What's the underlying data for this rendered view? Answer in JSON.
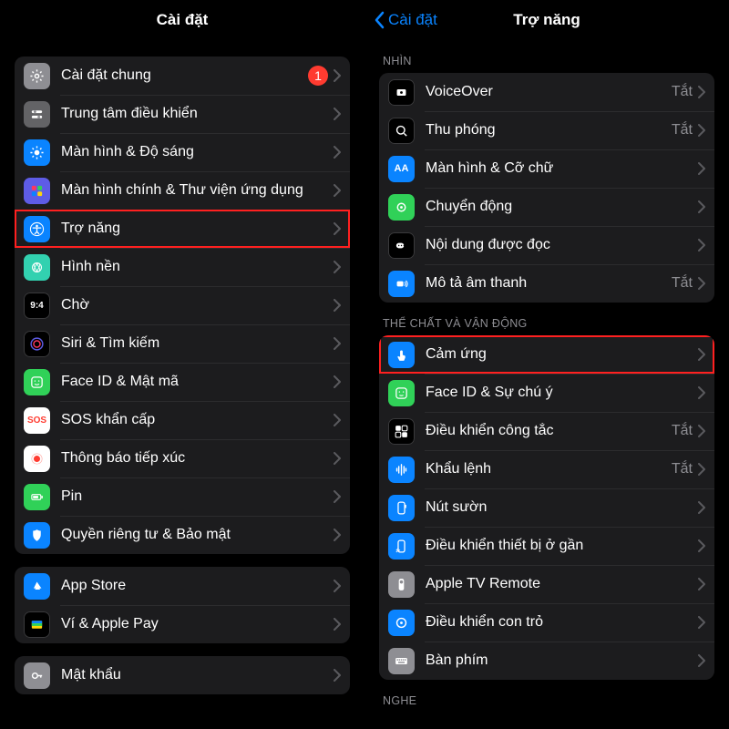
{
  "left": {
    "title": "Cài đặt",
    "groups": [
      {
        "items": [
          {
            "icon": "gear-icon",
            "cls": "c-gray",
            "label": "Cài đặt chung",
            "badge": "1"
          },
          {
            "icon": "control-center-icon",
            "cls": "c-dgray",
            "label": "Trung tâm điều khiển"
          },
          {
            "icon": "brightness-icon",
            "cls": "c-blue",
            "label": "Màn hình & Độ sáng"
          },
          {
            "icon": "home-screen-icon",
            "cls": "c-purple",
            "label": "Màn hình chính & Thư viện ứng dụng"
          },
          {
            "icon": "accessibility-icon",
            "cls": "c-blue",
            "label": "Trợ năng",
            "hl": true
          },
          {
            "icon": "wallpaper-icon",
            "cls": "c-mint",
            "label": "Hình nền"
          },
          {
            "icon": "standby-icon",
            "cls": "c-black",
            "label": "Chờ"
          },
          {
            "icon": "siri-icon",
            "cls": "c-black",
            "label": "Siri & Tìm kiếm"
          },
          {
            "icon": "faceid-icon",
            "cls": "c-green",
            "label": "Face ID & Mật mã"
          },
          {
            "icon": "sos-icon",
            "cls": "c-sos",
            "label": "SOS khẩn cấp"
          },
          {
            "icon": "exposure-icon",
            "cls": "c-white",
            "label": "Thông báo tiếp xúc"
          },
          {
            "icon": "battery-icon",
            "cls": "c-green",
            "label": "Pin"
          },
          {
            "icon": "privacy-icon",
            "cls": "c-blue",
            "label": "Quyền riêng tư & Bảo mật"
          }
        ]
      },
      {
        "items": [
          {
            "icon": "appstore-icon",
            "cls": "c-blue",
            "label": "App Store"
          },
          {
            "icon": "wallet-icon",
            "cls": "c-black",
            "label": "Ví & Apple Pay"
          }
        ]
      },
      {
        "items": [
          {
            "icon": "passwords-icon",
            "cls": "c-gray",
            "label": "Mật khẩu"
          }
        ]
      }
    ]
  },
  "right": {
    "back": "Cài đặt",
    "title": "Trợ năng",
    "sections": [
      {
        "header": "NHÌN",
        "items": [
          {
            "icon": "voiceover-icon",
            "cls": "c-black",
            "label": "VoiceOver",
            "trail": "Tắt"
          },
          {
            "icon": "zoom-icon",
            "cls": "c-black",
            "label": "Thu phóng",
            "trail": "Tắt"
          },
          {
            "icon": "textsize-icon",
            "cls": "c-blue",
            "label": "Màn hình & Cỡ chữ"
          },
          {
            "icon": "motion-icon",
            "cls": "c-green",
            "label": "Chuyển động"
          },
          {
            "icon": "spoken-icon",
            "cls": "c-black",
            "label": "Nội dung được đọc"
          },
          {
            "icon": "audiodesc-icon",
            "cls": "c-blue",
            "label": "Mô tả âm thanh",
            "trail": "Tắt"
          }
        ]
      },
      {
        "header": "THỂ CHẤT VÀ VẬN ĐỘNG",
        "items": [
          {
            "icon": "touch-icon",
            "cls": "c-blue",
            "label": "Cảm ứng",
            "hl": true
          },
          {
            "icon": "attention-icon",
            "cls": "c-green",
            "label": "Face ID & Sự chú ý"
          },
          {
            "icon": "switch-icon",
            "cls": "c-black",
            "label": "Điều khiển công tắc",
            "trail": "Tắt"
          },
          {
            "icon": "voice-icon",
            "cls": "c-blue",
            "label": "Khẩu lệnh",
            "trail": "Tắt"
          },
          {
            "icon": "sidebutton-icon",
            "cls": "c-blue",
            "label": "Nút sườn"
          },
          {
            "icon": "nearby-icon",
            "cls": "c-blue",
            "label": "Điều khiển thiết bị ở gần"
          },
          {
            "icon": "appletv-icon",
            "cls": "c-gray",
            "label": "Apple TV Remote"
          },
          {
            "icon": "pointer-icon",
            "cls": "c-blue",
            "label": "Điều khiển con trỏ"
          },
          {
            "icon": "keyboard-icon",
            "cls": "c-gray",
            "label": "Bàn phím"
          }
        ]
      },
      {
        "header": "NGHE",
        "items": []
      }
    ]
  }
}
